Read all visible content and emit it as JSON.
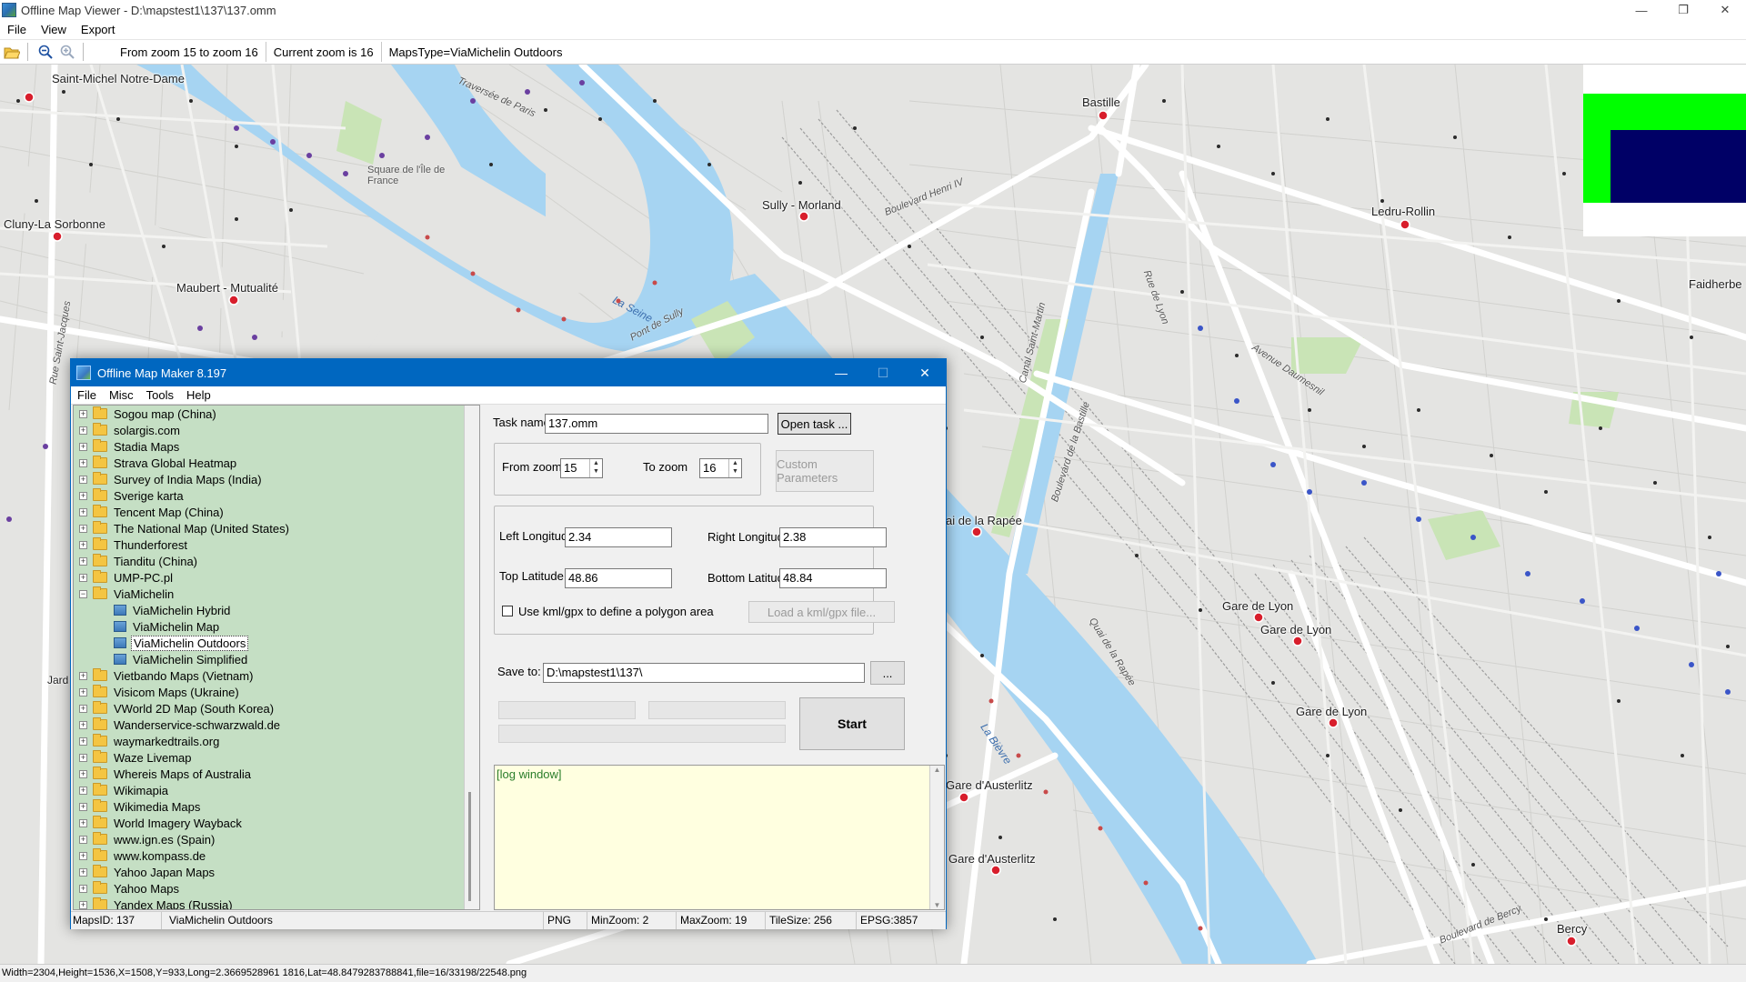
{
  "window": {
    "title": "Offline Map Viewer - D:\\mapstest1\\137\\137.omm",
    "minimize_glyph": "—",
    "maximize_glyph": "❐",
    "close_glyph": "✕"
  },
  "menu": [
    "File",
    "View",
    "Export"
  ],
  "toolbar": {
    "zoom_range": "From zoom 15 to zoom 16",
    "current_zoom": "Current zoom is 16",
    "maps_type": "MapsType=ViaMichelin Outdoors"
  },
  "map": {
    "place_labels": [
      "Saint-Michel Notre-Dame",
      "Cluny-La Sorbonne",
      "Maubert - Mutualité",
      "Sully - Morland",
      "Bastille",
      "Ledru-Rollin",
      "Faidherbe",
      "Gare de Lyon",
      "Gare de Lyon",
      "Gare de Lyon",
      "Gare d'Austerlitz",
      "Gare d'Austerlitz",
      "Bercy",
      "ai de la Rapée",
      "Square de l'Île de France",
      "Jard"
    ],
    "street_labels": [
      "Traversée de Paris",
      "Boulevard Henri IV",
      "La Seine",
      "Pont de Sully",
      "Avenue Daumesnil",
      "Quai de la Rapée",
      "Boulevard de la Bastille",
      "Canal Saint-Martin",
      "Rue de Lyon",
      "Boulevard de Bercy",
      "La Bièvre",
      "Rue Saint-Jacques"
    ],
    "colors": {
      "land": "#e4e4e2",
      "water": "#a6d4f2",
      "road": "#ffffff",
      "park": "#c9e4b6",
      "metro_marker": "#d81e2c",
      "overlay_green": "#00ff00",
      "overlay_navy": "#000066"
    }
  },
  "dialog": {
    "title": "Offline Map Maker 8.197",
    "menu": [
      "File",
      "Misc",
      "Tools",
      "Help"
    ],
    "tree_items": [
      {
        "label": "Sogou map (China)",
        "type": "folder"
      },
      {
        "label": "solargis.com",
        "type": "folder"
      },
      {
        "label": "Stadia Maps",
        "type": "folder"
      },
      {
        "label": "Strava Global Heatmap",
        "type": "folder"
      },
      {
        "label": "Survey of India Maps (India)",
        "type": "folder"
      },
      {
        "label": "Sverige karta",
        "type": "folder"
      },
      {
        "label": "Tencent Map (China)",
        "type": "folder"
      },
      {
        "label": "The National Map (United States)",
        "type": "folder"
      },
      {
        "label": "Thunderforest",
        "type": "folder"
      },
      {
        "label": "Tianditu (China)",
        "type": "folder"
      },
      {
        "label": "UMP-PC.pl",
        "type": "folder"
      },
      {
        "label": "ViaMichelin",
        "type": "folder-open"
      },
      {
        "label": "ViaMichelin Hybrid",
        "type": "map"
      },
      {
        "label": "ViaMichelin Map",
        "type": "map"
      },
      {
        "label": "ViaMichelin Outdoors",
        "type": "map",
        "selected": true
      },
      {
        "label": "ViaMichelin Simplified",
        "type": "map"
      },
      {
        "label": "Vietbando Maps (Vietnam)",
        "type": "folder"
      },
      {
        "label": "Visicom Maps (Ukraine)",
        "type": "folder"
      },
      {
        "label": "VWorld 2D Map (South Korea)",
        "type": "folder"
      },
      {
        "label": "Wanderservice-schwarzwald.de",
        "type": "folder"
      },
      {
        "label": "waymarkedtrails.org",
        "type": "folder"
      },
      {
        "label": "Waze Livemap",
        "type": "folder"
      },
      {
        "label": "Whereis Maps of Australia",
        "type": "folder"
      },
      {
        "label": "Wikimapia",
        "type": "folder"
      },
      {
        "label": "Wikimedia Maps",
        "type": "folder"
      },
      {
        "label": "World Imagery Wayback",
        "type": "folder"
      },
      {
        "label": "www.ign.es (Spain)",
        "type": "folder"
      },
      {
        "label": "www.kompass.de",
        "type": "folder"
      },
      {
        "label": "Yahoo Japan Maps",
        "type": "folder"
      },
      {
        "label": "Yahoo Maps",
        "type": "folder"
      },
      {
        "label": "Yandex Maps (Russia)",
        "type": "folder"
      }
    ],
    "task_name_label": "Task name",
    "task_name_value": "137.omm",
    "open_task_label": "Open task ...",
    "from_zoom_label": "From zoom",
    "from_zoom_value": "15",
    "to_zoom_label": "To zoom",
    "to_zoom_value": "16",
    "custom_params_label": "Custom Parameters",
    "left_lon_label": "Left Longitude",
    "left_lon_value": "2.34",
    "right_lon_label": "Right Longitude",
    "right_lon_value": "2.38",
    "top_lat_label": "Top Latitude",
    "top_lat_value": "48.86",
    "bottom_lat_label": "Bottom Latitude",
    "bottom_lat_value": "48.84",
    "kml_checkbox_label": "Use kml/gpx to define a polygon area",
    "kml_checked": false,
    "load_kml_label": "Load a kml/gpx file...",
    "save_to_label": "Save to:",
    "save_to_value": "D:\\mapstest1\\137\\",
    "browse_label": "...",
    "start_label": "Start",
    "log_text": "[log window]",
    "status": {
      "maps_id": "MapsID: 137",
      "maps_name": "ViaMichelin Outdoors",
      "format": "PNG",
      "min_zoom": "MinZoom: 2",
      "max_zoom": "MaxZoom: 19",
      "tile_size": "TileSize: 256",
      "epsg": "EPSG:3857"
    }
  },
  "statusbar": "Width=2304,Height=1536,X=1508,Y=933,Long=2.3669528961 1816,Lat=48.8479283788841,file=16/33198/22548.png"
}
